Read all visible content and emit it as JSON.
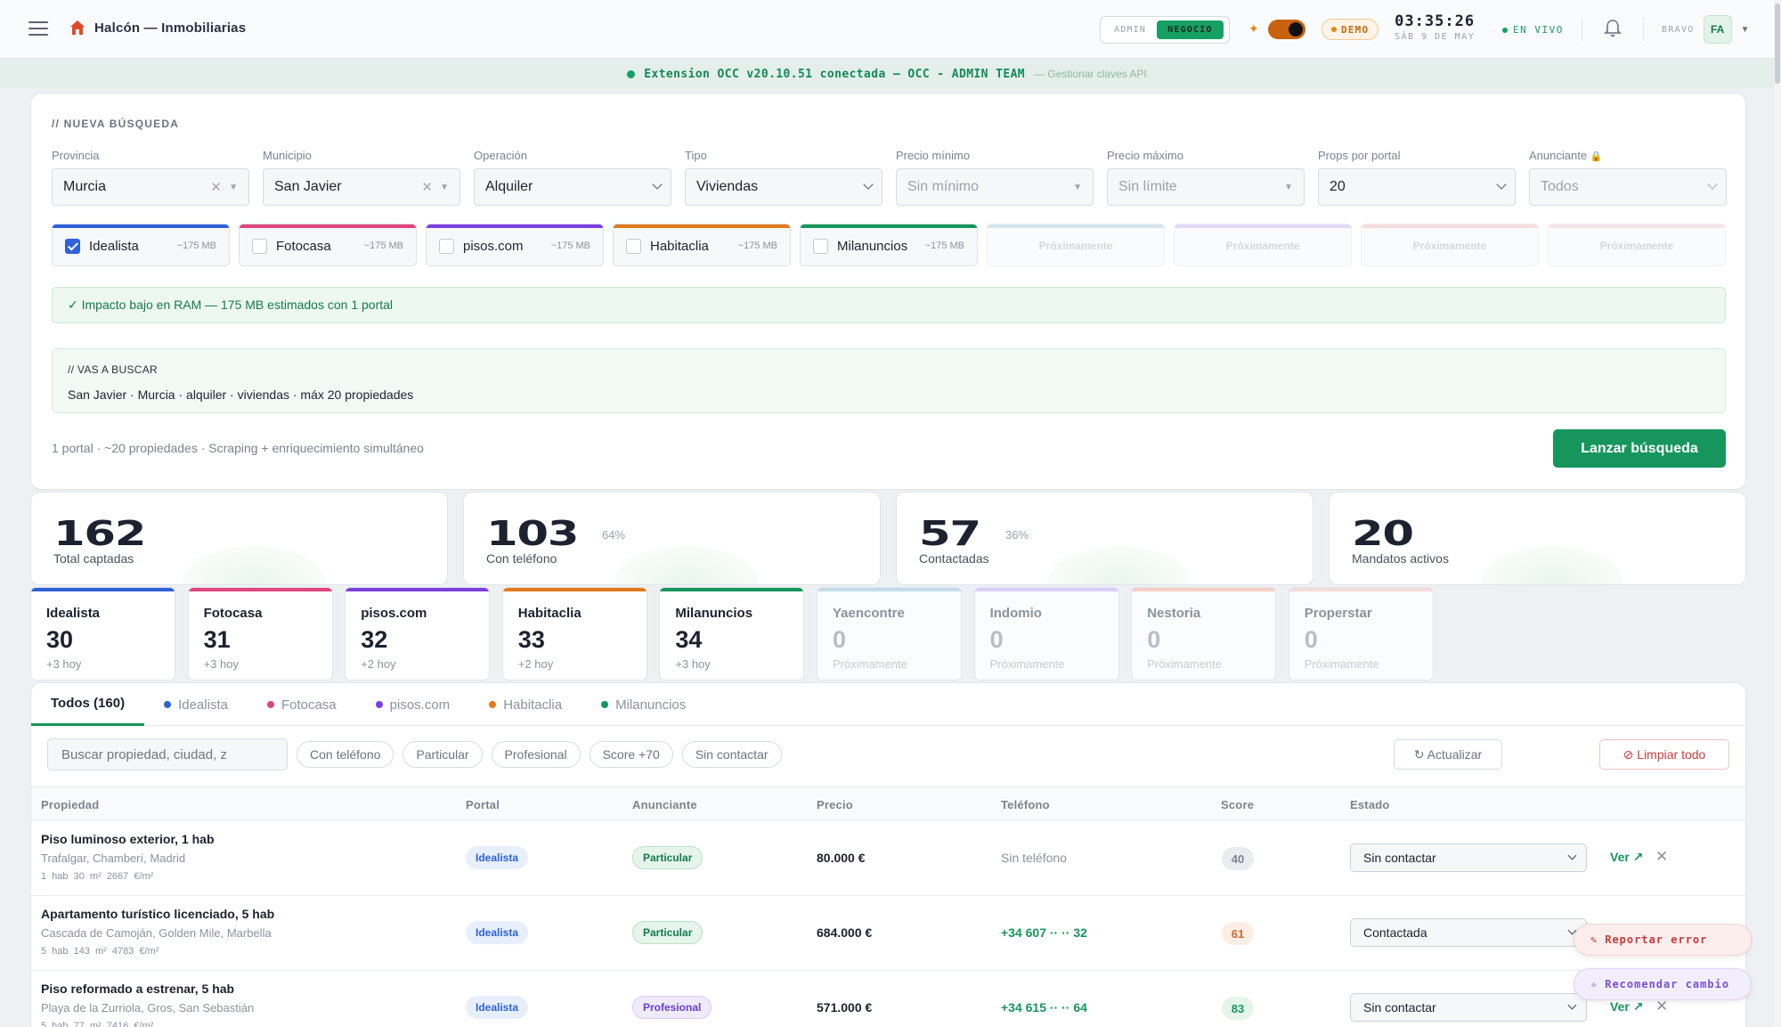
{
  "header": {
    "app_title": "Halcón — Inmobiliarias",
    "modes": [
      "ADMIN",
      "NEGOCIO"
    ],
    "active_mode": "NEGOCIO",
    "demo_label": "DEMO",
    "time": "03:35:26",
    "date": "SÁB 9 DE MAY",
    "live_label": "EN VIVO",
    "user_name": "BRAVO",
    "user_initials": "FA"
  },
  "banner": {
    "text": "Extension OCC v20.10.51 conectada — OCC - ADMIN TEAM",
    "link": "— Gestionar claves API"
  },
  "search": {
    "section_title": "// NUEVA BÚSQUEDA",
    "fields": [
      {
        "label": "Provincia",
        "value": "Murcia"
      },
      {
        "label": "Municipio",
        "value": "San Javier"
      },
      {
        "label": "Operación",
        "value": "Alquiler"
      },
      {
        "label": "Tipo",
        "value": "Viviendas"
      },
      {
        "label": "Precio mínimo",
        "value": "Sin mínimo"
      },
      {
        "label": "Precio máximo",
        "value": "Sin límite"
      },
      {
        "label": "Props por portal",
        "value": "20"
      },
      {
        "label": "Anunciante",
        "value": "Todos"
      }
    ],
    "portals": [
      {
        "name": "Idealista",
        "size": "~175 MB",
        "color": "#2f62d8",
        "checked": true
      },
      {
        "name": "Fotocasa",
        "size": "~175 MB",
        "color": "#e0457b",
        "checked": false
      },
      {
        "name": "pisos.com",
        "size": "~175 MB",
        "color": "#7b3fe0",
        "checked": false
      },
      {
        "name": "Habitaclia",
        "size": "~175 MB",
        "color": "#e07a1a",
        "checked": false
      },
      {
        "name": "Milanuncios",
        "size": "~175 MB",
        "color": "#16965d",
        "checked": false
      }
    ],
    "soon_label": "Próximamente",
    "soon_colors": [
      "#8fb9d8",
      "#b99ff0",
      "#f0a9a9",
      "#f0b9b9"
    ],
    "ram_note": "✓ Impacto bajo en RAM — 175 MB estimados con 1 portal",
    "summary_title": "// VAS A BUSCAR",
    "summary_text": "San Javier · Murcia · alquiler · viviendas · máx 20 propiedades",
    "footer_text": "1 portal · ~20 propiedades · Scraping + enriquecimiento simultáneo",
    "launch_label": "Lanzar búsqueda"
  },
  "stats": [
    {
      "value": "162",
      "pct": "",
      "label": "Total captadas"
    },
    {
      "value": "103",
      "pct": "64%",
      "label": "Con teléfono"
    },
    {
      "value": "57",
      "pct": "36%",
      "label": "Contactadas"
    },
    {
      "value": "20",
      "pct": "",
      "label": "Mandatos activos"
    }
  ],
  "portal_counts": [
    {
      "name": "Idealista",
      "count": "30",
      "sub": "+3 hoy",
      "color": "#2f62d8"
    },
    {
      "name": "Fotocasa",
      "count": "31",
      "sub": "+3 hoy",
      "color": "#e0457b"
    },
    {
      "name": "pisos.com",
      "count": "32",
      "sub": "+2 hoy",
      "color": "#7b3fe0"
    },
    {
      "name": "Habitaclia",
      "count": "33",
      "sub": "+2 hoy",
      "color": "#e07a1a"
    },
    {
      "name": "Milanuncios",
      "count": "34",
      "sub": "+3 hoy",
      "color": "#16965d"
    },
    {
      "name": "Yaencontre",
      "count": "0",
      "sub": "Próximamente",
      "color": "#8fb9d8"
    },
    {
      "name": "Indomio",
      "count": "0",
      "sub": "Próximamente",
      "color": "#b99ff0"
    },
    {
      "name": "Nestoria",
      "count": "0",
      "sub": "Próximamente",
      "color": "#f0a28a"
    },
    {
      "name": "Properstar",
      "count": "0",
      "sub": "Próximamente",
      "color": "#f0b9b9"
    }
  ],
  "table": {
    "tabs": [
      {
        "label": "Todos (160)",
        "color": ""
      },
      {
        "label": "Idealista",
        "color": "#2f62d8"
      },
      {
        "label": "Fotocasa",
        "color": "#e0457b"
      },
      {
        "label": "pisos.com",
        "color": "#7b3fe0"
      },
      {
        "label": "Habitaclia",
        "color": "#e07a1a"
      },
      {
        "label": "Milanuncios",
        "color": "#16965d"
      }
    ],
    "search_placeholder": "Buscar propiedad, ciudad, z",
    "chips": [
      "Con teléfono",
      "Particular",
      "Profesional",
      "Score +70",
      "Sin contactar"
    ],
    "refresh_label": "↻ Actualizar",
    "clear_label": "⊘ Limpiar todo",
    "columns": [
      "Propiedad",
      "Portal",
      "Anunciante",
      "Precio",
      "Teléfono",
      "Score",
      "Estado"
    ],
    "rows": [
      {
        "title": "Piso luminoso exterior, 1 hab",
        "location": "Trafalgar, Chamberí, Madrid",
        "meta": "1 hab  30 m²  2667 €/m²",
        "portal": "Idealista",
        "advertiser": "Particular",
        "price": "80.000 €",
        "phone": "Sin teléfono",
        "score": "40",
        "status": "Sin contactar"
      },
      {
        "title": "Apartamento turístico licenciado, 5 hab",
        "location": "Cascada de Camoján, Golden Mile, Marbella",
        "meta": "5 hab  143 m²  4783 €/m²",
        "portal": "Idealista",
        "advertiser": "Particular",
        "price": "684.000 €",
        "phone": "+34 607 ·· ·· 32",
        "score": "61",
        "status": "Contactada"
      },
      {
        "title": "Piso reformado a estrenar, 5 hab",
        "location": "Playa de la Zurriola, Gros, San Sebastián",
        "meta": "5 hab  77 m²  7416 €/m²",
        "portal": "Idealista",
        "advertiser": "Profesional",
        "price": "571.000 €",
        "phone": "+34 615 ·· ·· 64",
        "score": "83",
        "status": "Sin contactar"
      }
    ],
    "view_label": "Ver ↗"
  },
  "floating": {
    "report": "Reportar error",
    "recommend": "Recomendar cambio"
  }
}
